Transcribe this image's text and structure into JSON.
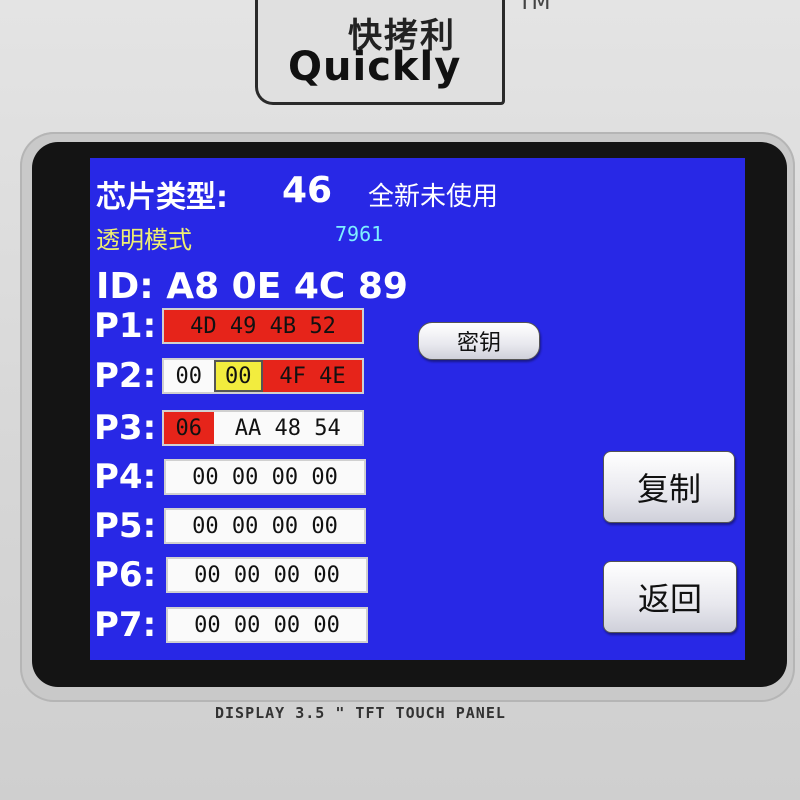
{
  "logo": {
    "cn": "快拷利",
    "en": "Quickly",
    "tm": "TM"
  },
  "caption": "DISPLAY 3.5 \" TFT TOUCH PANEL",
  "screen": {
    "chip_label": "芯片类型:",
    "chip_value": "46",
    "chip_status": "全新未使用",
    "mode_label": "透明模式",
    "mode_value": "7961",
    "id_line": "ID: A8 0E 4C 89",
    "key_button": "密钥",
    "copy_button": "复制",
    "back_button": "返回",
    "rows": [
      {
        "label": "P1:",
        "cells": [
          {
            "text": "4D 49 4B 52",
            "color": "red"
          }
        ]
      },
      {
        "label": "P2:",
        "cells": [
          {
            "text": "00",
            "color": "white"
          },
          {
            "text": "00",
            "color": "yellow"
          },
          {
            "text": "4F 4E",
            "color": "red"
          }
        ]
      },
      {
        "label": "P3:",
        "cells": [
          {
            "text": "06",
            "color": "red"
          },
          {
            "text": "AA 48 54",
            "color": "white"
          }
        ]
      },
      {
        "label": "P4:",
        "cells": [
          {
            "text": "00 00 00 00",
            "color": "white"
          }
        ]
      },
      {
        "label": "P5:",
        "cells": [
          {
            "text": "00 00 00 00",
            "color": "white"
          }
        ]
      },
      {
        "label": "P6:",
        "cells": [
          {
            "text": "00 00 00 00",
            "color": "white"
          }
        ]
      },
      {
        "label": "P7:",
        "cells": [
          {
            "text": "00 00 00 00",
            "color": "white"
          }
        ]
      }
    ]
  },
  "colors": {
    "screen_bg": "#2828e6",
    "red": "#e6241a",
    "yellow": "#f2ec3e",
    "mode_label": "#f0f070",
    "mode_value": "#7ef0ff"
  }
}
